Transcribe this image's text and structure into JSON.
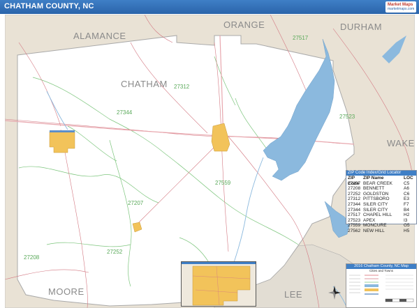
{
  "header": {
    "title": "CHATHAM COUNTY, NC",
    "logo_line1": "Market Maps",
    "logo_line2": "marketmaps.com"
  },
  "regions": {
    "alamance": "ALAMANCE",
    "orange": "ORANGE",
    "durham": "DURHAM",
    "chatham": "CHATHAM",
    "wake": "WAKE",
    "moore": "MOORE",
    "lee": "LEE"
  },
  "zips": {
    "z27312": "27312",
    "z27344": "27344",
    "z27517": "27517",
    "z27523": "27523",
    "z27559": "27559",
    "z27207": "27207",
    "z27252": "27252",
    "z27208": "27208"
  },
  "zip_table": {
    "title": "ZIP Code Index/Grid Locator",
    "headers": [
      "ZIP Code",
      "ZIP Name",
      "LOC"
    ],
    "rows": [
      [
        "27207",
        "BEAR CREEK",
        "C5"
      ],
      [
        "27208",
        "BENNETT",
        "A6"
      ],
      [
        "27252",
        "GOLDSTON",
        "C6"
      ],
      [
        "27312",
        "PITTSBORO",
        "E3"
      ],
      [
        "27344",
        "SILER CITY",
        "F7"
      ],
      [
        "27344",
        "SILER CITY",
        "B4"
      ],
      [
        "27517",
        "CHAPEL HILL",
        "H2"
      ],
      [
        "27523",
        "APEX",
        "I3"
      ],
      [
        "27559",
        "MONCURE",
        "G5"
      ],
      [
        "27562",
        "NEW HILL",
        "H5"
      ]
    ]
  },
  "legend": {
    "title": "2016 Chatham County, NC Map",
    "subtitle": "Cities and Towns"
  },
  "colors": {
    "header": "#3f7fc6",
    "land_outside": "#e8e1d4",
    "county": "#ffffff",
    "water": "#8bb9de",
    "city": "#f2c35a",
    "road": "#d9707c",
    "highway": "#e7a0a8",
    "zip_boundary": "#6ec26e"
  }
}
